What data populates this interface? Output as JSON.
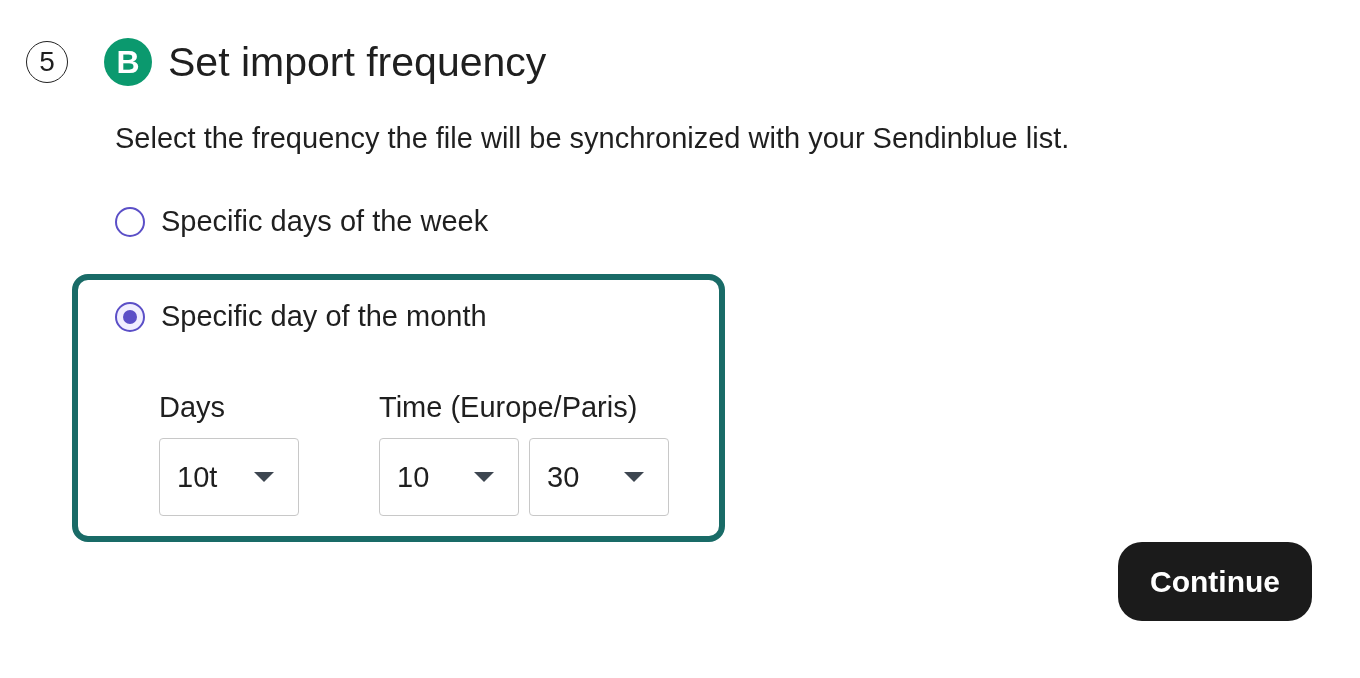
{
  "step": {
    "number": "5",
    "logo_letter": "B",
    "title": "Set import frequency"
  },
  "description": "Select the frequency the file will be synchronized with your Sendinblue list.",
  "options": [
    {
      "label": "Specific days of the week",
      "selected": false
    },
    {
      "label": "Specific day of the month",
      "selected": true,
      "fields": [
        {
          "label": "Days",
          "selects": [
            "10t"
          ]
        },
        {
          "label": "Time (Europe/Paris)",
          "selects": [
            "10",
            "30"
          ]
        }
      ]
    }
  ],
  "button": "Continue"
}
